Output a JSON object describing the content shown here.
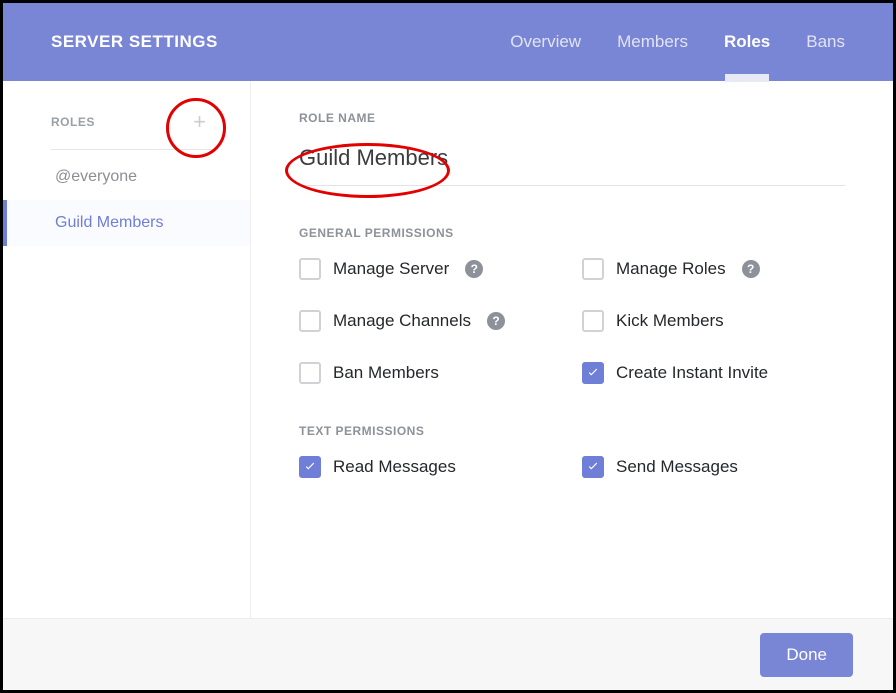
{
  "header": {
    "title": "SERVER SETTINGS",
    "tabs": [
      {
        "label": "Overview",
        "active": false
      },
      {
        "label": "Members",
        "active": false
      },
      {
        "label": "Roles",
        "active": true
      },
      {
        "label": "Bans",
        "active": false
      }
    ]
  },
  "sidebar": {
    "title": "ROLES",
    "items": [
      {
        "label": "@everyone",
        "active": false
      },
      {
        "label": "Guild Members",
        "active": true
      }
    ]
  },
  "main": {
    "role_name_label": "ROLE NAME",
    "role_name_value": "Guild Members",
    "sections": [
      {
        "title": "GENERAL PERMISSIONS",
        "perms": [
          {
            "label": "Manage Server",
            "checked": false,
            "help": true
          },
          {
            "label": "Manage Roles",
            "checked": false,
            "help": true
          },
          {
            "label": "Manage Channels",
            "checked": false,
            "help": true
          },
          {
            "label": "Kick Members",
            "checked": false,
            "help": false
          },
          {
            "label": "Ban Members",
            "checked": false,
            "help": false
          },
          {
            "label": "Create Instant Invite",
            "checked": true,
            "help": false
          }
        ]
      },
      {
        "title": "TEXT PERMISSIONS",
        "perms": [
          {
            "label": "Read Messages",
            "checked": true,
            "help": false
          },
          {
            "label": "Send Messages",
            "checked": true,
            "help": false
          }
        ]
      }
    ]
  },
  "footer": {
    "done_label": "Done"
  }
}
